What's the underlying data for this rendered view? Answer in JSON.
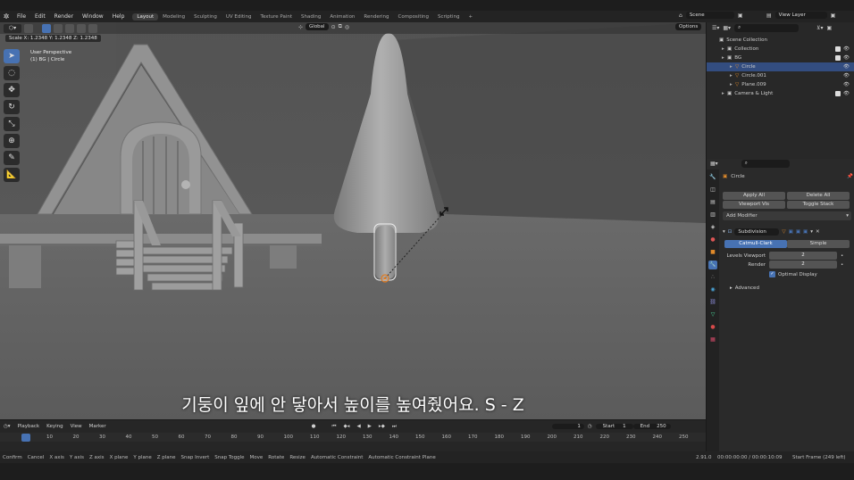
{
  "menu": [
    "File",
    "Edit",
    "Render",
    "Window",
    "Help"
  ],
  "workspaces": [
    {
      "label": "Layout",
      "active": true
    },
    {
      "label": "Modeling",
      "active": false
    },
    {
      "label": "Sculpting",
      "active": false
    },
    {
      "label": "UV Editing",
      "active": false
    },
    {
      "label": "Texture Paint",
      "active": false
    },
    {
      "label": "Shading",
      "active": false
    },
    {
      "label": "Animation",
      "active": false
    },
    {
      "label": "Rendering",
      "active": false
    },
    {
      "label": "Compositing",
      "active": false
    },
    {
      "label": "Scripting",
      "active": false
    }
  ],
  "add_workspace": "+",
  "scene": {
    "label": "Scene"
  },
  "view_layer": {
    "label": "View Layer"
  },
  "viewport": {
    "orientation": "Global",
    "options": "Options",
    "scale_readout": "Scale X: 1.2348   Y: 1.2348   Z: 1.2348",
    "view_name": "User Perspective",
    "view_object": "(1) BG | Circle",
    "subtitle": "기둥이 잎에 안 닿아서 높이를 높여줬어요. S - Z"
  },
  "timeline": {
    "playback": "Playback",
    "keying": "Keying",
    "view": "View",
    "marker": "Marker",
    "current_frame": "1",
    "start_label": "Start",
    "start": "1",
    "end_label": "End",
    "end": "250",
    "ticks": [
      "1",
      "10",
      "20",
      "30",
      "40",
      "50",
      "60",
      "70",
      "80",
      "90",
      "100",
      "110",
      "120",
      "130",
      "140",
      "150",
      "160",
      "170",
      "180",
      "190",
      "200",
      "210",
      "220",
      "230",
      "240",
      "250"
    ]
  },
  "statusbar": {
    "items": [
      "Confirm",
      "Cancel",
      "X axis",
      "Y axis",
      "Z axis",
      "X plane",
      "Y plane",
      "Z plane",
      "Snap Invert",
      "Snap Toggle",
      "Move",
      "Rotate",
      "Resize",
      "Automatic Constraint",
      "Automatic Constraint Plane"
    ],
    "version": "2.91.0",
    "time": "00:00:00:00 / 00:00:10:09",
    "frame_info": "Start Frame (249 left)"
  },
  "outliner": {
    "rows": [
      {
        "label": "Scene Collection",
        "indent": 0,
        "selected": false
      },
      {
        "label": "Collection",
        "indent": 1,
        "selected": false
      },
      {
        "label": "BG",
        "indent": 1,
        "selected": false
      },
      {
        "label": "Circle",
        "indent": 2,
        "selected": true
      },
      {
        "label": "Circle.001",
        "indent": 2,
        "selected": false
      },
      {
        "label": "Plane.009",
        "indent": 2,
        "selected": false
      },
      {
        "label": "Camera & Light",
        "indent": 1,
        "selected": false
      }
    ]
  },
  "properties": {
    "object_name": "Circle",
    "apply_all": "Apply All",
    "delete_all": "Delete All",
    "viewport_vis": "Viewport Vis",
    "toggle_stack": "Toggle Stack",
    "add_modifier": "Add Modifier",
    "modifier_name": "Subdivision",
    "catmull": "Catmull-Clark",
    "simple": "Simple",
    "levels_label": "Levels Viewport",
    "levels_value": "2",
    "render_label": "Render",
    "render_value": "2",
    "optimal_display": "Optimal Display",
    "advanced": "Advanced"
  },
  "colors": {
    "accent": "#4772b3",
    "selection": "#334d80"
  }
}
